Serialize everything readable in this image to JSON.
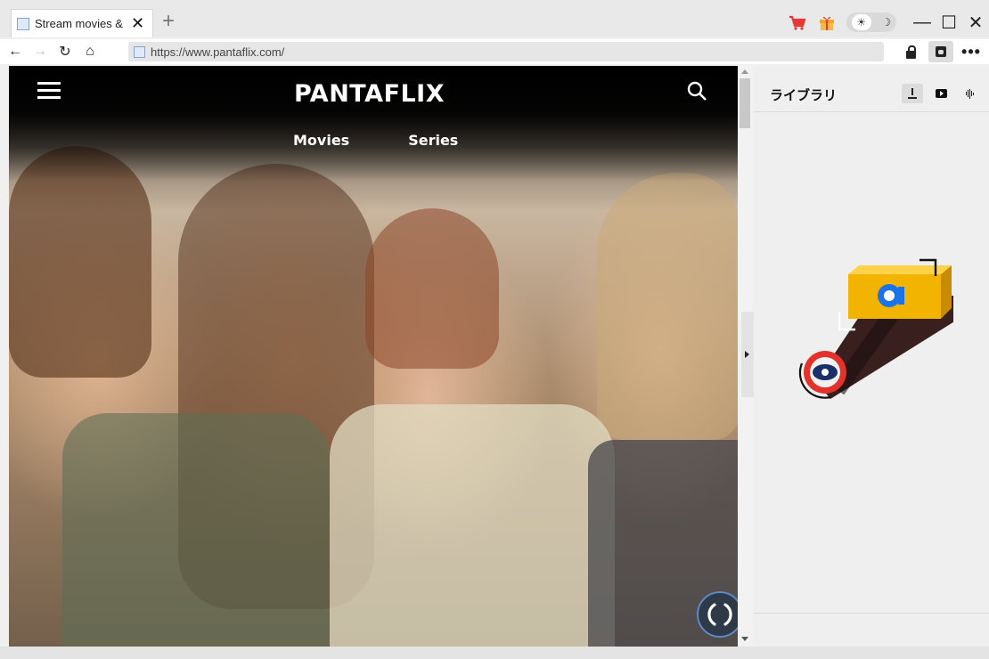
{
  "browser": {
    "tab_title": "Stream movies &",
    "tab_close_label": "✕",
    "new_tab_label": "+",
    "url": "https://www.pantaflix.com/",
    "theme_toggle": {
      "light": "☀",
      "dark": "☽"
    },
    "window_controls": {
      "minimize": "—",
      "maximize": "☐",
      "close": "✕"
    },
    "nav": {
      "back": "←",
      "forward": "→",
      "reload": "↻",
      "home": "⌂"
    },
    "more_label": "•••",
    "colors": {
      "cart": "#e53935",
      "gift": "#f5a623"
    }
  },
  "site": {
    "logo": "PANTAFLIX",
    "nav": [
      "Movies",
      "Series"
    ]
  },
  "panel": {
    "title": "ライブラリ",
    "tools": [
      "download-icon",
      "youtube-icon",
      "audio-wave-icon"
    ]
  }
}
